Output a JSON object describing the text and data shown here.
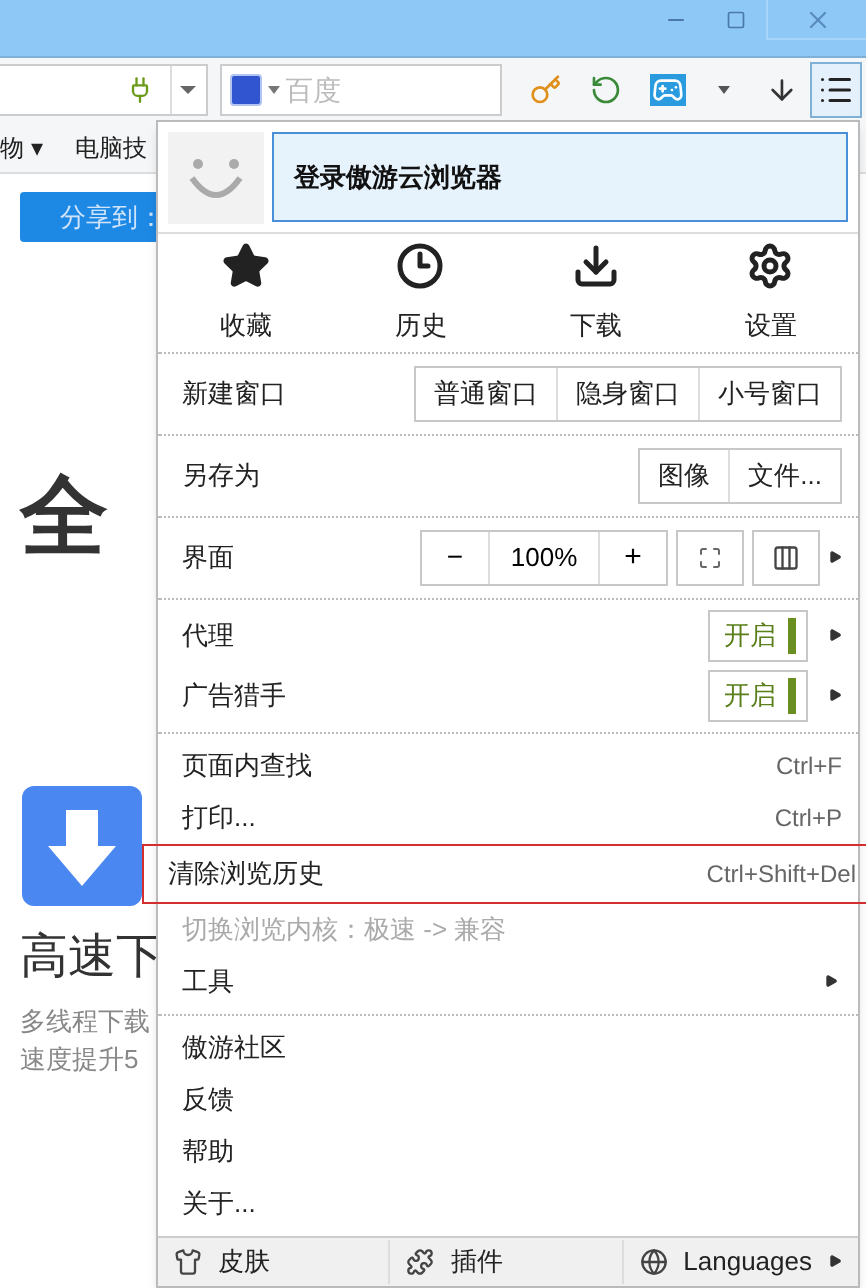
{
  "toolbar": {
    "search": {
      "placeholder": "百度"
    },
    "menu_button": {
      "selected": true
    }
  },
  "bookmarks": [
    {
      "label": "物 ▾"
    },
    {
      "label": "电脑技"
    }
  ],
  "page": {
    "share": "分享到：",
    "headline": "全",
    "feature_title": "高速下",
    "feature_lines": [
      "多线程下载",
      "速度提升5"
    ]
  },
  "menu": {
    "login": "登录傲游云浏览器",
    "quick": [
      {
        "label": "收藏"
      },
      {
        "label": "历史"
      },
      {
        "label": "下载"
      },
      {
        "label": "设置"
      }
    ],
    "sections": [
      [
        {
          "kind": "buttons",
          "label": "新建窗口",
          "buttons": [
            "普通窗口",
            "隐身窗口",
            "小号窗口"
          ]
        }
      ],
      [
        {
          "kind": "buttons",
          "label": "另存为",
          "buttons": [
            "图像",
            "文件..."
          ]
        }
      ],
      [
        {
          "kind": "zoom",
          "label": "界面",
          "minus": "−",
          "value": "100%",
          "plus": "+"
        }
      ],
      [
        {
          "kind": "toggle",
          "label": "代理",
          "state": "开启",
          "on": true
        },
        {
          "kind": "toggle",
          "label": "广告猎手",
          "state": "开启",
          "on": true
        }
      ],
      [
        {
          "kind": "item",
          "label": "页面内查找",
          "shortcut": "Ctrl+F",
          "highlighted": false,
          "disabled": false
        },
        {
          "kind": "item",
          "label": "打印...",
          "shortcut": "Ctrl+P",
          "highlighted": false,
          "disabled": false
        },
        {
          "kind": "item",
          "label": "清除浏览历史",
          "shortcut": "Ctrl+Shift+Del",
          "highlighted": true,
          "disabled": false
        },
        {
          "kind": "item",
          "label": "切换浏览内核：极速 -> 兼容",
          "highlighted": false,
          "disabled": true
        },
        {
          "kind": "submenu",
          "label": "工具"
        }
      ],
      [
        {
          "kind": "item",
          "label": "傲游社区",
          "highlighted": false,
          "disabled": false
        },
        {
          "kind": "item",
          "label": "反馈",
          "highlighted": false,
          "disabled": false
        },
        {
          "kind": "item",
          "label": "帮助",
          "highlighted": false,
          "disabled": false
        },
        {
          "kind": "item",
          "label": "关于...",
          "highlighted": false,
          "disabled": false
        }
      ]
    ],
    "footer": [
      {
        "label": "皮肤",
        "submenu": false
      },
      {
        "label": "插件",
        "submenu": false
      },
      {
        "label": "Languages",
        "submenu": true
      }
    ]
  }
}
